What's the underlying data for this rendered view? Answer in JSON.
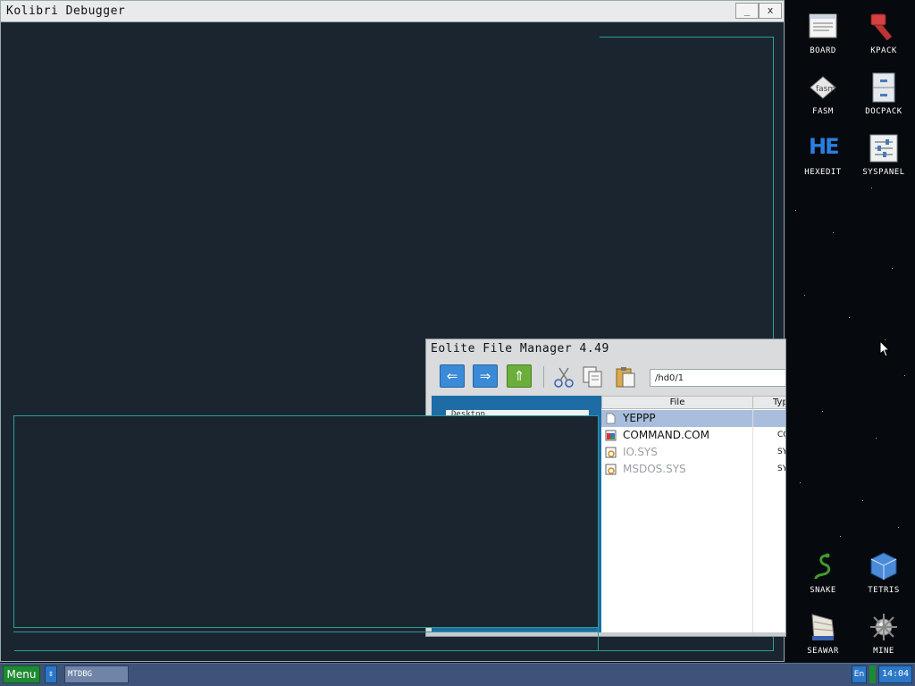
{
  "debugger": {
    "title": "Kolibri Debugger",
    "minimize_label": "_",
    "close_label": "x"
  },
  "eolite": {
    "title": "Eolite File Manager 4.49",
    "path": "/hd0/1",
    "left_item": "Desktop",
    "columns": {
      "file": "File",
      "type": "Typ"
    },
    "files": [
      {
        "name": "YEPPP",
        "type": "",
        "selected": true,
        "dim": false
      },
      {
        "name": "COMMAND.COM",
        "type": "CO",
        "selected": false,
        "dim": false
      },
      {
        "name": "IO.SYS",
        "type": "SY",
        "selected": false,
        "dim": true
      },
      {
        "name": "MSDOS.SYS",
        "type": "SY",
        "selected": false,
        "dim": true
      }
    ]
  },
  "desktop_icons": [
    {
      "label": "BOARD",
      "icon": "board-icon"
    },
    {
      "label": "KPACK",
      "icon": "kpack-icon"
    },
    {
      "label": "FASM",
      "icon": "fasm-icon"
    },
    {
      "label": "DOCPACK",
      "icon": "docpack-icon"
    },
    {
      "label": "HEXEDIT",
      "icon": "hexedit-icon"
    },
    {
      "label": "SYSPANEL",
      "icon": "syspanel-icon"
    },
    {
      "label": "SNAKE",
      "icon": "snake-icon"
    },
    {
      "label": "TETRIS",
      "icon": "tetris-icon"
    },
    {
      "label": "SEAWAR",
      "icon": "seawar-icon"
    },
    {
      "label": "MINE",
      "icon": "mine-icon"
    }
  ],
  "hexedit_glyph": "HE",
  "taskbar": {
    "menu_label": "Menu",
    "switch_label": "⇕",
    "task_label": "MTDBG",
    "lang": "En",
    "clock": "14:04"
  },
  "colors": {
    "debugger_bg": "#1b2530",
    "panel_outline": "#2a9d97",
    "taskbar": "#3e5378",
    "menu_green": "#1e8a33",
    "selection": "#a9bedc"
  }
}
